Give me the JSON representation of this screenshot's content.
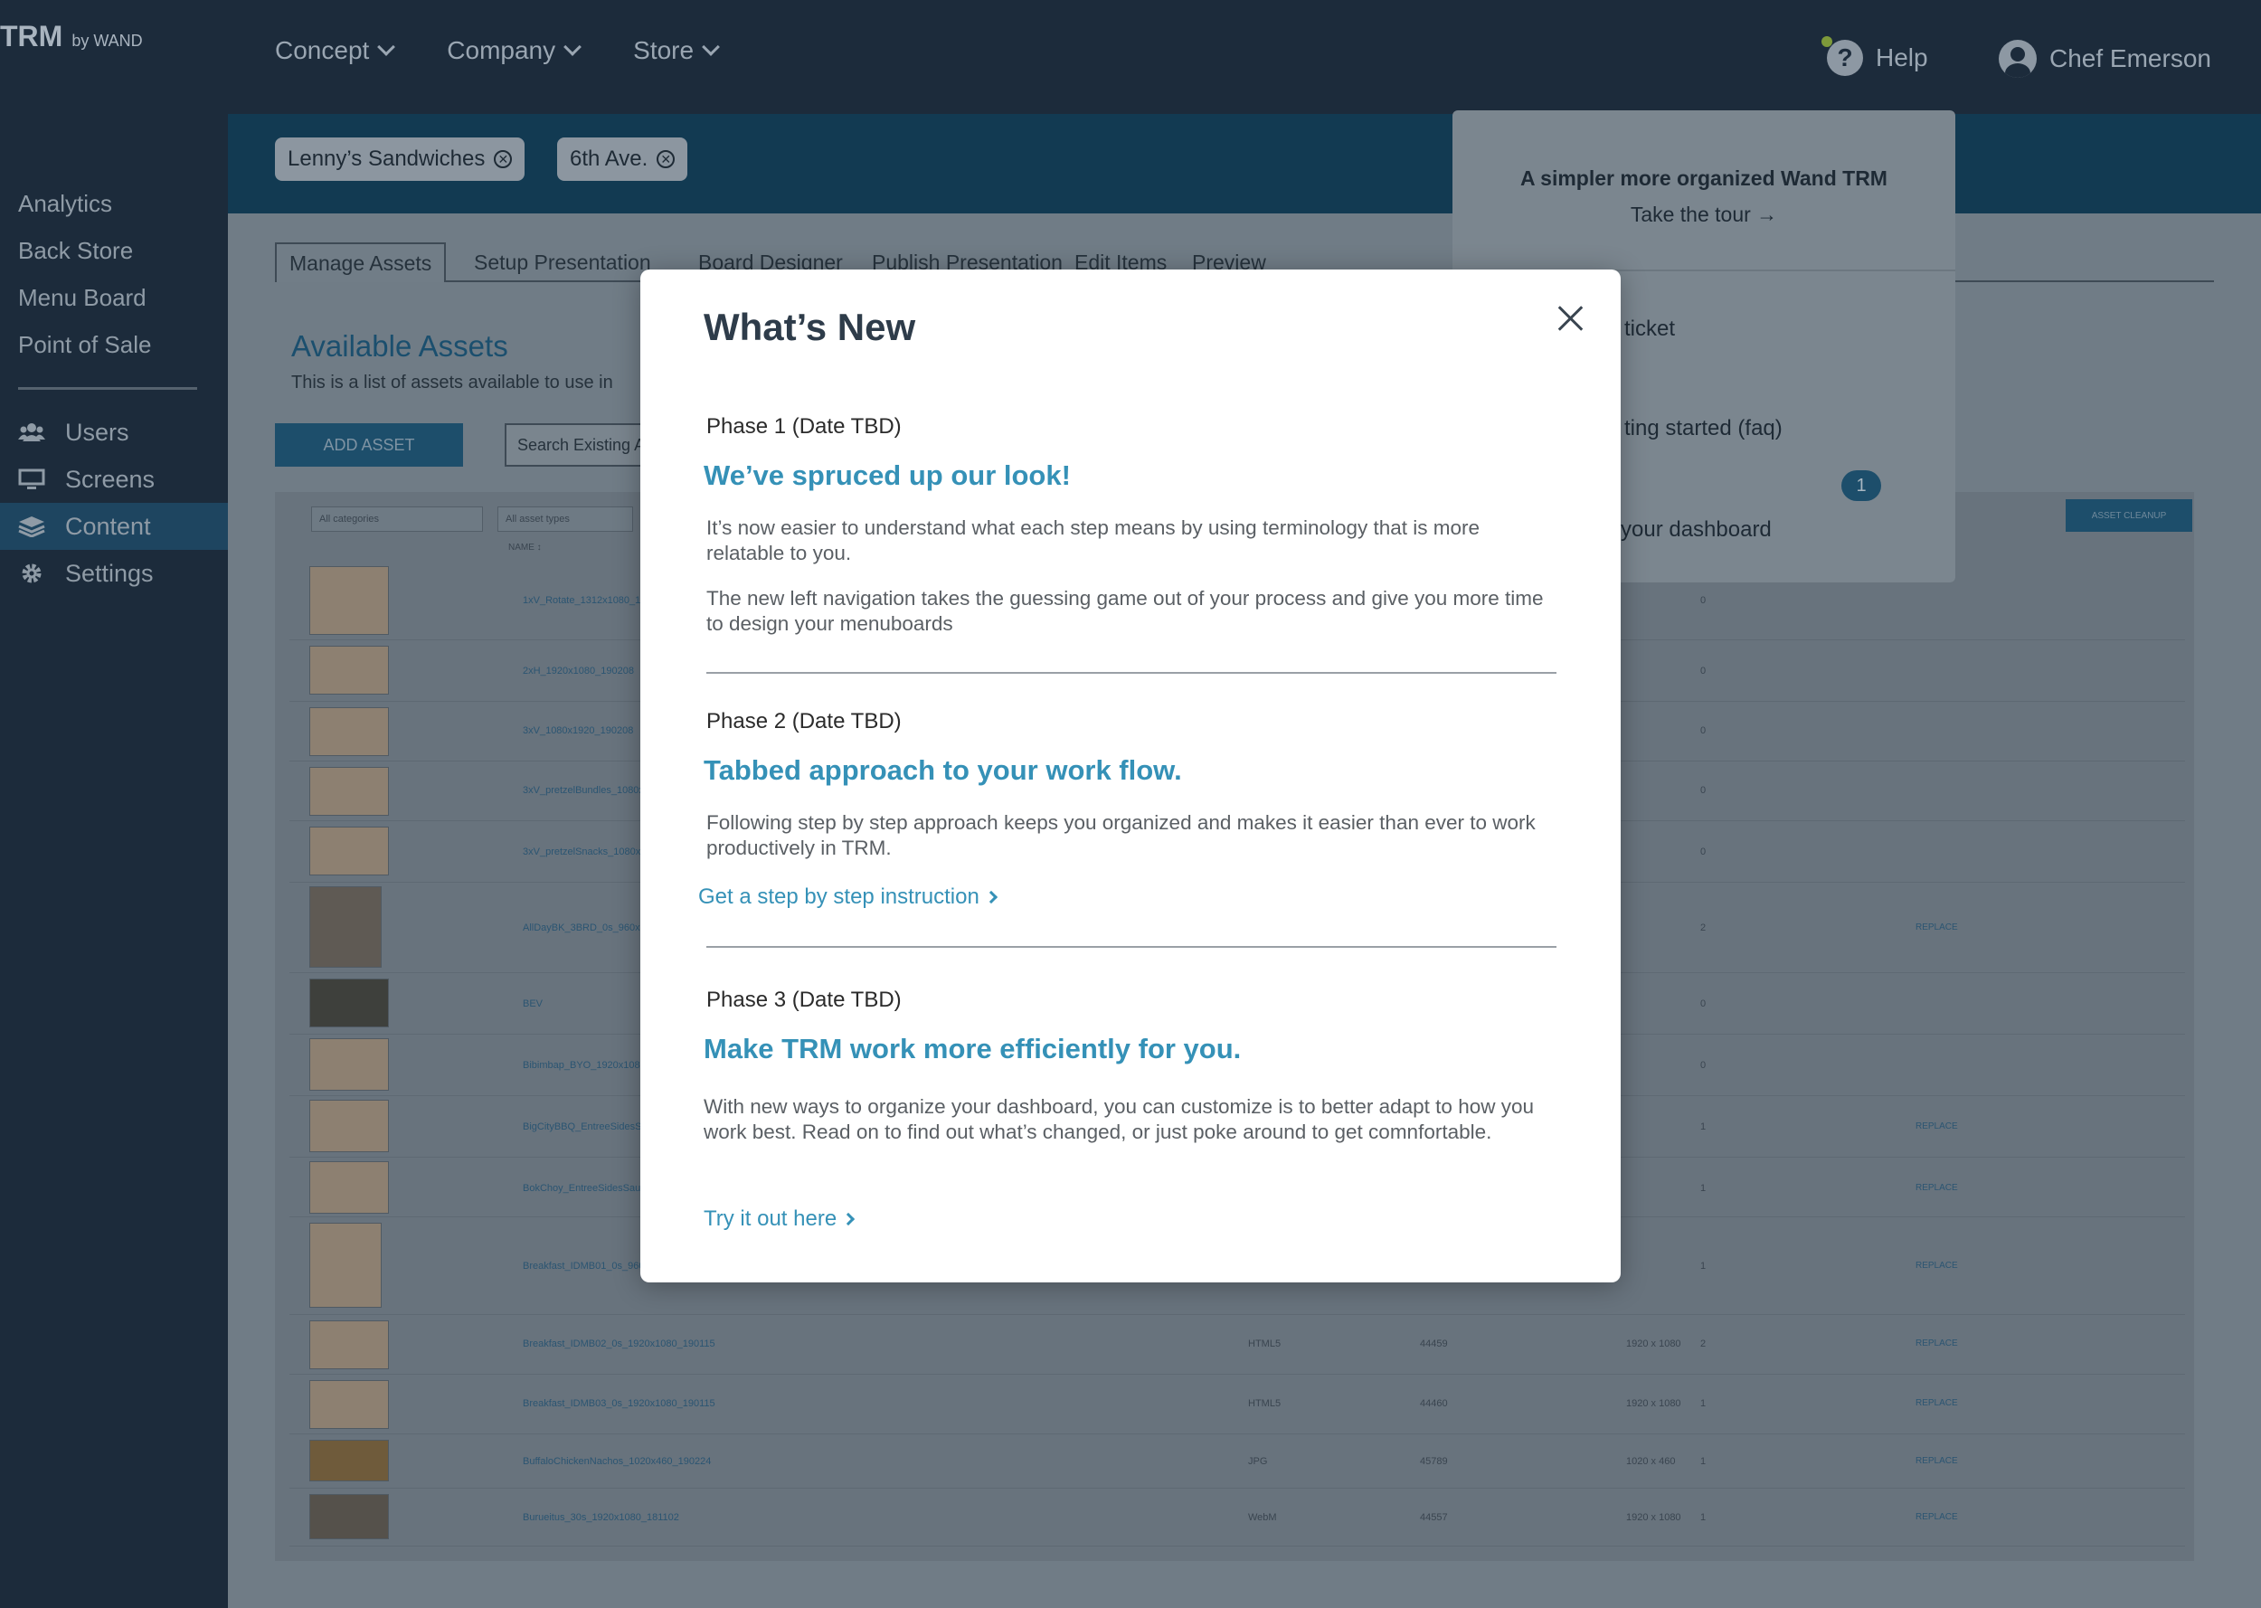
{
  "brand": {
    "name": "TRM",
    "by": "by WAND"
  },
  "topnav": [
    {
      "label": "Concept"
    },
    {
      "label": "Company"
    },
    {
      "label": "Store"
    }
  ],
  "header": {
    "help": "Help",
    "user": "Chef Emerson"
  },
  "sidebar": {
    "top_items": [
      {
        "label": "Analytics"
      },
      {
        "label": "Back Store"
      },
      {
        "label": "Menu Board"
      },
      {
        "label": "Point of Sale"
      }
    ],
    "icon_items": [
      {
        "label": "Users",
        "icon": "users-icon"
      },
      {
        "label": "Screens",
        "icon": "monitor-icon"
      },
      {
        "label": "Content",
        "icon": "layers-icon",
        "active": true
      },
      {
        "label": "Settings",
        "icon": "gear-icon"
      }
    ]
  },
  "chips": [
    {
      "label": "Lenny’s Sandwiches"
    },
    {
      "label": "6th Ave."
    }
  ],
  "tabs": [
    {
      "label": "Manage Assets",
      "active": true
    },
    {
      "label": "Setup Presentation"
    },
    {
      "label": "Board Designer"
    },
    {
      "label": "Publish Presentation"
    },
    {
      "label": "Edit Items"
    },
    {
      "label": "Preview"
    }
  ],
  "assets": {
    "title": "Available Assets",
    "subtitle": "This is a list of assets available to use in",
    "add_button": "ADD ASSET",
    "search_placeholder": "Search Existing A",
    "filter_categories": "All categories",
    "filter_types": "All asset types",
    "cleanup_button": "ASSET CLEANUP",
    "name_header": "NAME ↕"
  },
  "rows": [
    {
      "name": "1xV_Rotate_1312x1080_190",
      "type": "",
      "id": "",
      "res": "",
      "count": "0",
      "action": ""
    },
    {
      "name": "2xH_1920x1080_190208",
      "type": "",
      "id": "",
      "res": "",
      "count": "0",
      "action": ""
    },
    {
      "name": "3xV_1080x1920_190208",
      "type": "",
      "id": "",
      "res": "",
      "count": "0",
      "action": ""
    },
    {
      "name": "3xV_pretzelBundles_1080x1",
      "type": "",
      "id": "",
      "res": "",
      "count": "0",
      "action": ""
    },
    {
      "name": "3xV_pretzelSnacks_1080x19",
      "type": "",
      "id": "",
      "res": "",
      "count": "0",
      "action": ""
    },
    {
      "name": "AllDayBK_3BRD_0s_960x108",
      "type": "",
      "id": "",
      "res": "",
      "count": "2",
      "action": "REPLACE"
    },
    {
      "name": "BEV",
      "type": "",
      "id": "",
      "res": "",
      "count": "0",
      "action": ""
    },
    {
      "name": "Bibimbap_BYO_1920x1080_",
      "type": "",
      "id": "",
      "res": "",
      "count": "0",
      "action": ""
    },
    {
      "name": "BigCityBBQ_EntreeSidesSau",
      "type": "",
      "id": "",
      "res": "",
      "count": "1",
      "action": "REPLACE"
    },
    {
      "name": "BokChoy_EntreeSidesSauce",
      "type": "",
      "id": "",
      "res": "",
      "count": "1",
      "action": "REPLACE"
    },
    {
      "name": "Breakfast_IDMB01_0s_960x",
      "type": "",
      "id": "",
      "res": "",
      "count": "1",
      "action": "REPLACE"
    },
    {
      "name": "Breakfast_IDMB02_0s_1920x1080_190115",
      "type": "HTML5",
      "id": "44459",
      "res": "1920 x 1080",
      "count": "2",
      "action": "REPLACE"
    },
    {
      "name": "Breakfast_IDMB03_0s_1920x1080_190115",
      "type": "HTML5",
      "id": "44460",
      "res": "1920 x 1080",
      "count": "1",
      "action": "REPLACE"
    },
    {
      "name": "BuffaloChickenNachos_1020x460_190224",
      "type": "JPG",
      "id": "45789",
      "res": "1020 x 460",
      "count": "1",
      "action": "REPLACE"
    },
    {
      "name": "Burueitus_30s_1920x1080_181102",
      "type": "WebM",
      "id": "44557",
      "res": "1920 x 1080",
      "count": "1",
      "action": "REPLACE"
    }
  ],
  "tour": {
    "title": "A simpler more organized Wand TRM",
    "cta": "Take the tour →",
    "links": [
      {
        "label": "ticket"
      },
      {
        "label": "ting started (faq)"
      },
      {
        "label": "your dashboard"
      }
    ],
    "badge": "1"
  },
  "modal": {
    "title": "What’s New",
    "phases": [
      {
        "phase": "Phase 1 (Date TBD)",
        "heading": "We’ve spruced up our look!",
        "paragraphs": [
          "It’s now easier to understand what each step means by using terminology that is more relatable to you.",
          "The new left navigation takes the guessing game out of your process and give you more time to design your menuboards"
        ]
      },
      {
        "phase": "Phase 2 (Date TBD)",
        "heading": "Tabbed approach to your work flow.",
        "paragraphs": [
          "Following step by step approach keeps you organized and makes it easier than ever to work productively in TRM."
        ],
        "link": "Get a step by step instruction"
      },
      {
        "phase": "Phase 3 (Date TBD)",
        "heading": "Make TRM work more efficiently for you.",
        "paragraphs": [
          "With new ways to organize your dashboard, you can customize is to better adapt to how you work best. Read on to find out what’s changed, or just poke around to get comnfortable."
        ],
        "link": "Try it out here"
      }
    ]
  }
}
